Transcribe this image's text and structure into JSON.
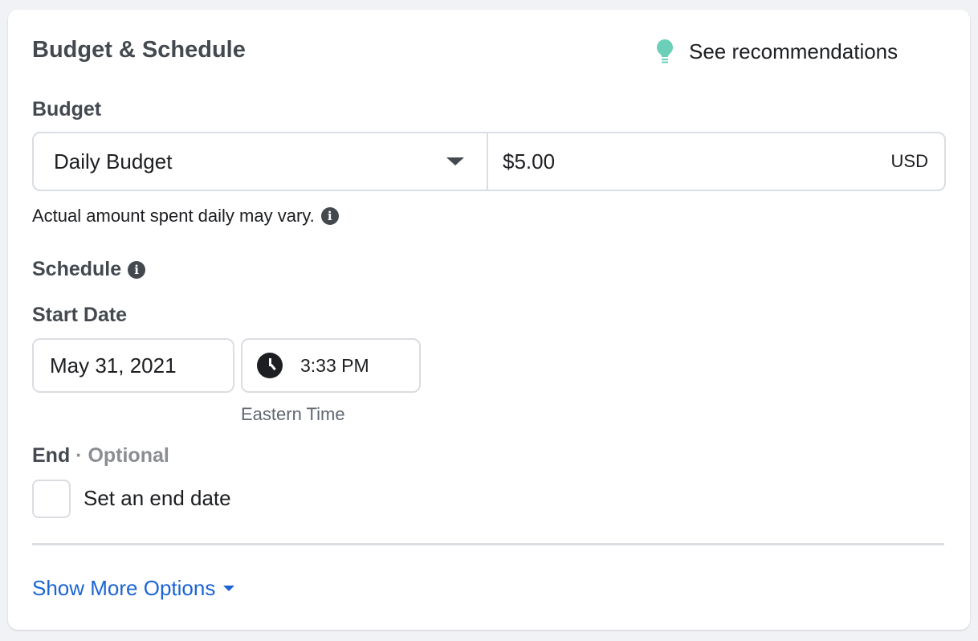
{
  "header": {
    "title": "Budget & Schedule",
    "recommendations_label": "See recommendations",
    "recommendations_icon": "lightbulb-icon",
    "icon_color": "#6cd0b8"
  },
  "budget": {
    "label": "Budget",
    "type": "Daily Budget",
    "amount": "$5.00",
    "currency": "USD",
    "note": "Actual amount spent daily may vary."
  },
  "schedule": {
    "label": "Schedule",
    "start_label": "Start Date",
    "start_date": "May 31, 2021",
    "start_time": "3:33 PM",
    "timezone": "Eastern Time"
  },
  "end": {
    "label": "End",
    "separator": " · ",
    "optional": "Optional",
    "checkbox_label": "Set an end date",
    "checked": false
  },
  "footer": {
    "show_more": "Show More Options",
    "link_color": "#1b64d3"
  }
}
